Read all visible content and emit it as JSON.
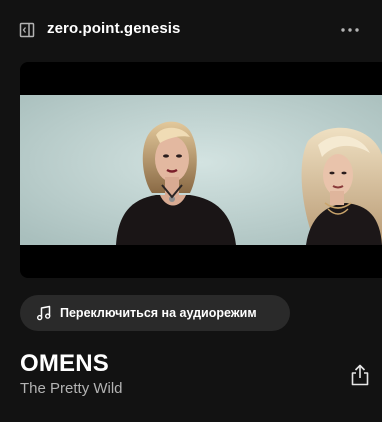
{
  "header": {
    "title": "zero.point.genesis",
    "collapse_icon": "sidebar-collapse-icon",
    "more_icon": "more-options-icon"
  },
  "video": {
    "description_icon": "music-video-frame"
  },
  "switch_button": {
    "label": "Переключиться на аудиорежим",
    "icon": "music-note-icon"
  },
  "track": {
    "title": "OMENS",
    "artist": "The Pretty Wild",
    "share_icon": "share-icon"
  },
  "colors": {
    "background": "#121212",
    "button_bg": "#2a2a2a",
    "primary_text": "#ffffff",
    "secondary_text": "#b3b3b3"
  }
}
